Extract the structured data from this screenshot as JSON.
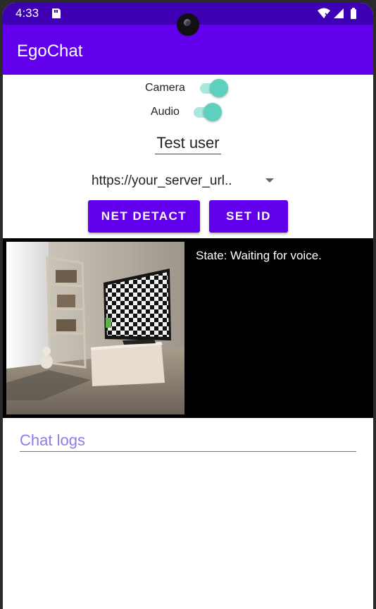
{
  "status_bar": {
    "time": "4:33",
    "icons": [
      "sd-card-icon",
      "wifi-icon",
      "signal-icon",
      "battery-icon"
    ]
  },
  "app_bar": {
    "title": "EgoChat"
  },
  "controls": {
    "camera_label": "Camera",
    "camera_on": true,
    "audio_label": "Audio",
    "audio_on": true,
    "user_id_value": "Test user",
    "server_select_value": "https://your_server_url..",
    "net_detect_label": "NET DETACT",
    "set_id_label": "SET ID"
  },
  "video": {
    "state_text": "State: Waiting for voice."
  },
  "chat": {
    "hint": "Chat logs"
  },
  "colors": {
    "primary": "#6200ee",
    "status_bar": "#3e00b3",
    "switch_thumb": "#5ed0bf",
    "switch_track": "#a9e8dc",
    "hint_text": "#8c7cf0"
  }
}
